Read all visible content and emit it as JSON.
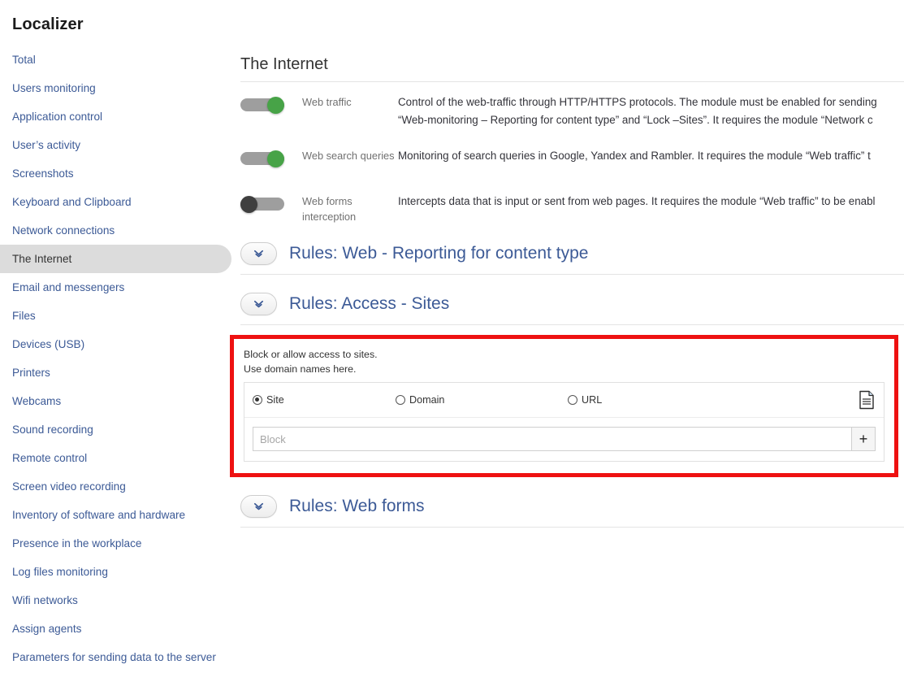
{
  "brand": "Localizer",
  "sidebar": {
    "items": [
      {
        "label": "Total",
        "selected": false
      },
      {
        "label": "Users monitoring",
        "selected": false
      },
      {
        "label": "Application control",
        "selected": false
      },
      {
        "label": "User’s activity",
        "selected": false
      },
      {
        "label": "Screenshots",
        "selected": false
      },
      {
        "label": "Keyboard and Clipboard",
        "selected": false
      },
      {
        "label": "Network connections",
        "selected": false
      },
      {
        "label": "The Internet",
        "selected": true
      },
      {
        "label": "Email and messengers",
        "selected": false
      },
      {
        "label": "Files",
        "selected": false
      },
      {
        "label": "Devices (USB)",
        "selected": false
      },
      {
        "label": "Printers",
        "selected": false
      },
      {
        "label": "Webcams",
        "selected": false
      },
      {
        "label": "Sound recording",
        "selected": false
      },
      {
        "label": "Remote control",
        "selected": false
      },
      {
        "label": "Screen video recording",
        "selected": false
      },
      {
        "label": "Inventory of software and hardware",
        "selected": false
      },
      {
        "label": "Presence in the workplace",
        "selected": false
      },
      {
        "label": "Log files monitoring",
        "selected": false
      },
      {
        "label": "Wifi networks",
        "selected": false
      },
      {
        "label": "Assign agents",
        "selected": false
      },
      {
        "label": "Parameters for sending data to the server",
        "selected": false
      }
    ]
  },
  "main": {
    "page_title": "The Internet",
    "toggles": [
      {
        "label": "Web traffic",
        "state": "on",
        "description": "Control of the web-traffic through HTTP/HTTPS protocols. The module must be enabled for sending\n“Web-monitoring – Reporting for content type” and “Lock –Sites”. It requires the module “Network c"
      },
      {
        "label": "Web search queries",
        "state": "on",
        "description": "Monitoring of search queries in Google, Yandex and Rambler. It requires the module “Web traffic” t"
      },
      {
        "label": "Web forms interception",
        "state": "off",
        "description": "Intercepts data that is input or sent from web pages. It requires the module “Web traffic” to be enabl"
      }
    ],
    "sections": [
      {
        "title": "Rules: Web - Reporting for content type"
      },
      {
        "title": "Rules: Access - Sites"
      },
      {
        "title": "Rules: Web forms"
      }
    ],
    "access_sites_panel": {
      "help_line1": "Block or allow access to sites.",
      "help_line2": "Use domain names here.",
      "radios": [
        {
          "label": "Site",
          "checked": true
        },
        {
          "label": "Domain",
          "checked": false
        },
        {
          "label": "URL",
          "checked": false
        }
      ],
      "doc_icon": "document-icon",
      "input_value": "",
      "input_placeholder": "Block",
      "add_label": "+"
    }
  },
  "colors": {
    "highlight_border": "#ee1111",
    "toggle_on": "#47a347",
    "toggle_off": "#3f3f3f",
    "link": "#3c5a96",
    "selected_bg": "#dcdcdc"
  }
}
